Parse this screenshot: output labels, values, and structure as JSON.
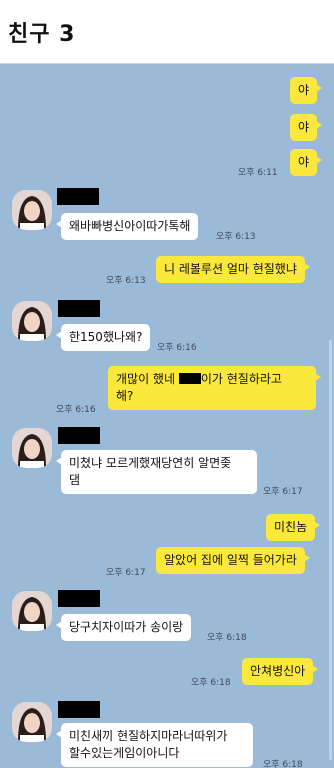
{
  "chat": {
    "title": "친구 3"
  },
  "messages": {
    "m1": "야",
    "m2": "야",
    "m3": "야",
    "t1": "오후 6:11",
    "m4": "왜바빠병신아이따가톡해",
    "t4": "오후 6:13",
    "m5": "니 레볼루션 얼마 현질했냐",
    "t5": "오후 6:13",
    "m6": "한150했나왜?",
    "t6": "오후 6:16",
    "m7a": "개많이 했네 ",
    "m7b": "이가 현질하라고",
    "m7c": "해?",
    "t7": "오후 6:16",
    "m8a": "미쳤냐 모르게했재당연히 알면좆",
    "m8b": "댐",
    "t8": "오후 6:17",
    "m9": "미친놈",
    "m10": "알았어 집에 일찍 들어가라",
    "t10": "오후 6:17",
    "m11": "당구치자이따가 송이랑",
    "t11": "오후 6:18",
    "m12": "안쳐병신아",
    "t12": "오후 6:18",
    "m13a": "미친새끼 현질하지마라너따위가",
    "m13b": "할수있는게임이아니다",
    "t13": "오후 6:18"
  },
  "colors": {
    "background": "#9bbad8",
    "my_bubble": "#fbe83d",
    "friend_bubble": "#ffffff",
    "header": "#ffffff"
  },
  "icons": {
    "avatar": "profile-photo"
  }
}
